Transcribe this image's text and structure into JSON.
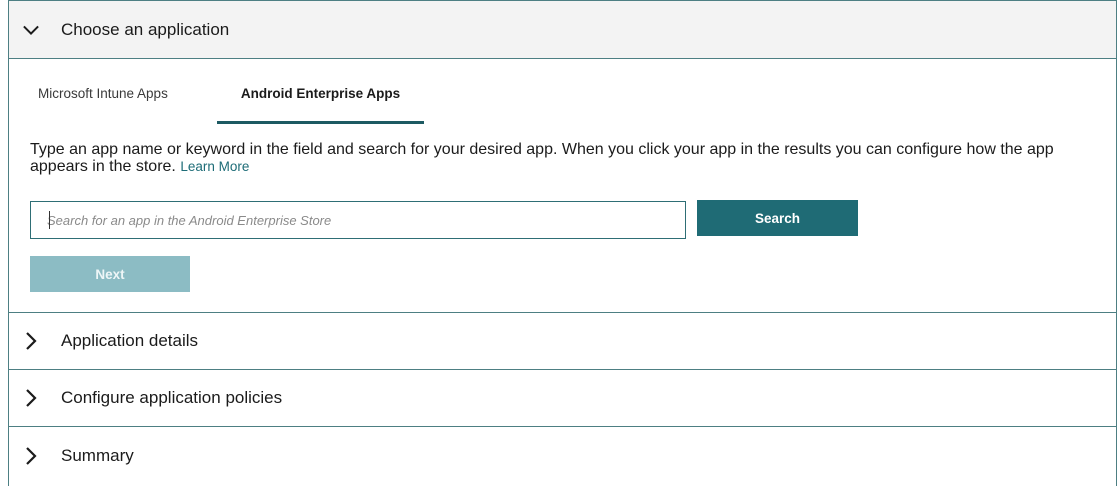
{
  "sections": {
    "choose": {
      "title": "Choose an application"
    },
    "details": {
      "title": "Application details"
    },
    "policies": {
      "title": "Configure application policies"
    },
    "summary": {
      "title": "Summary"
    }
  },
  "tabs": [
    {
      "label": "Microsoft Intune Apps"
    },
    {
      "label": "Android Enterprise Apps"
    }
  ],
  "description": {
    "text": "Type an app name or keyword in the field and search for your desired app. When you click your app in the results you can configure how the app appears in the store. ",
    "link": "Learn More"
  },
  "search": {
    "placeholder": "Search for an app in the Android Enterprise Store",
    "value": "",
    "button_label": "Search"
  },
  "next": {
    "label": "Next"
  },
  "colors": {
    "accent": "#1f6b75",
    "accent_disabled": "#8cbcc4",
    "border": "#4d7f83",
    "tab_underline": "#1d5a62"
  },
  "icons": {
    "open_section": "chevron-down-icon",
    "closed_section": "chevron-right-icon"
  }
}
